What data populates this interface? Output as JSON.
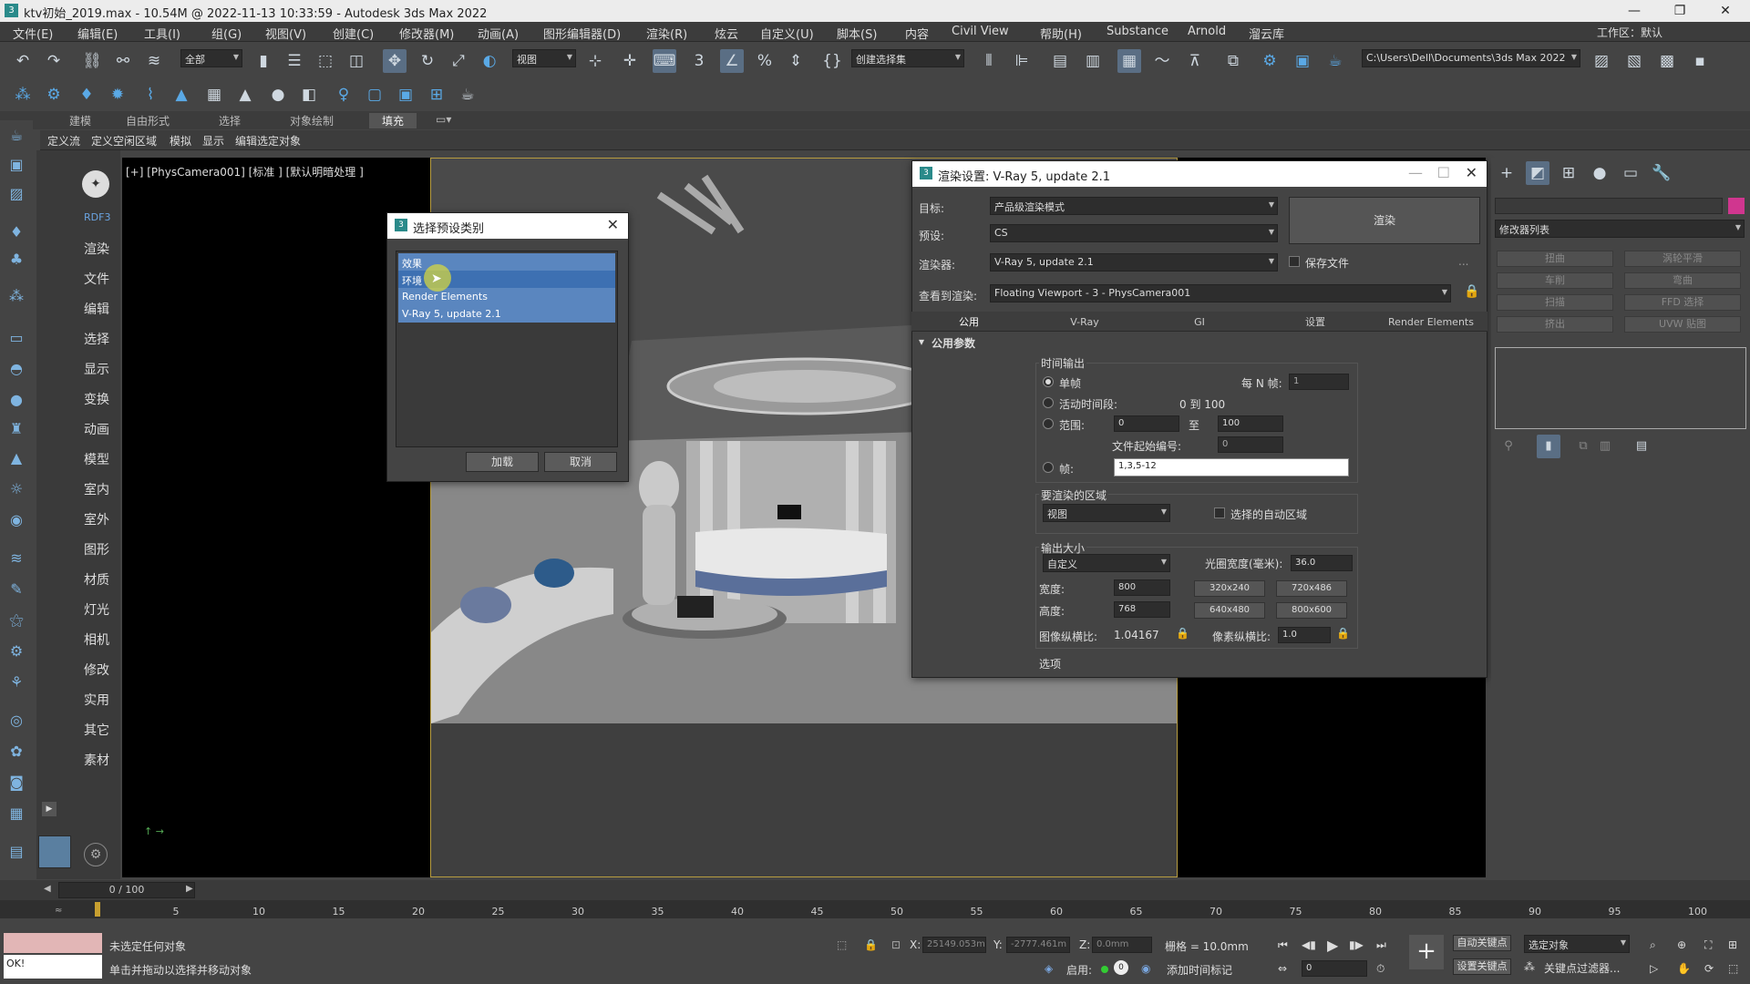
{
  "app": {
    "title": "ktv初始_2019.max - 10.54M @ 2022-11-13 10:33:59 - Autodesk 3ds Max 2022",
    "workspace_label": "工作区：",
    "workspace_value": "默认"
  },
  "menu": [
    "文件(E)",
    "编辑(E)",
    "工具(I)",
    "组(G)",
    "视图(V)",
    "创建(C)",
    "修改器(M)",
    "动画(A)",
    "图形编辑器(D)",
    "渲染(R)",
    "炫云",
    "自定义(U)",
    "脚本(S)",
    "内容",
    "Civil View",
    "帮助(H)",
    "Substance",
    "Arnold",
    "溜云库"
  ],
  "toolbar": {
    "filter_dropdown": "全部",
    "view_dropdown": "视图",
    "selection_set_dropdown": "创建选择集",
    "path_dropdown": "C:\\Users\\Dell\\Documents\\3ds Max 2022"
  },
  "ribbon": {
    "tabs": [
      "建模",
      "自由形式",
      "选择",
      "对象绘制",
      "填充"
    ],
    "active_tab": "填充",
    "sub_items": [
      "定义流",
      "定义空闲区域",
      "模拟",
      "显示",
      "编辑选定对象"
    ]
  },
  "side_commands": {
    "logo_label": "RDF3",
    "items": [
      "渲染",
      "文件",
      "编辑",
      "选择",
      "显示",
      "变换",
      "动画",
      "模型",
      "室内",
      "室外",
      "图形",
      "材质",
      "灯光",
      "相机",
      "修改",
      "实用",
      "其它",
      "素材"
    ]
  },
  "viewport": {
    "label": "[+] [PhysCamera001] [标准 ] [默认明暗处理 ]"
  },
  "preset_dialog": {
    "title": "选择预设类别",
    "items": [
      "效果",
      "环境",
      "Render Elements",
      "V-Ray 5, update 2.1"
    ],
    "load_button": "加载",
    "cancel_button": "取消"
  },
  "render_setup": {
    "title": "渲染设置: V-Ray 5, update 2.1",
    "target_label": "目标:",
    "target_value": "产品级渲染模式",
    "preset_label": "预设:",
    "preset_value": "CS",
    "renderer_label": "渲染器:",
    "renderer_value": "V-Ray 5, update 2.1",
    "save_file_label": "保存文件",
    "view_label": "查看到渲染:",
    "view_value": "Floating Viewport - 3 - PhysCamera001",
    "render_button": "渲染",
    "more_label": "...",
    "tabs": [
      "公用",
      "V-Ray",
      "GI",
      "设置",
      "Render Elements"
    ],
    "active_tab": "公用",
    "rollout_title": "公用参数",
    "time_output": {
      "group_label": "时间输出",
      "single": "单帧",
      "every_n_label": "每 N 帧:",
      "every_n_value": "1",
      "active_segment": "活动时间段:",
      "active_range": "0 到 100",
      "range": "范围:",
      "range_from": "0",
      "range_to_label": "至",
      "range_to": "100",
      "file_number_label": "文件起始编号:",
      "file_number_value": "0",
      "frames_label": "帧:",
      "frames_value": "1,3,5-12"
    },
    "area": {
      "group_label": "要渲染的区域",
      "dropdown": "视图",
      "auto_region": "选择的自动区域"
    },
    "output_size": {
      "group_label": "输出大小",
      "dropdown": "自定义",
      "aperture_label": "光圈宽度(毫米):",
      "aperture_value": "36.0",
      "width_label": "宽度:",
      "width_value": "800",
      "height_label": "高度:",
      "height_value": "768",
      "presets": [
        "320x240",
        "720x486",
        "640x480",
        "800x600"
      ],
      "image_aspect_label": "图像纵横比:",
      "image_aspect_value": "1.04167",
      "pixel_aspect_label": "像素纵横比:",
      "pixel_aspect_value": "1.0"
    },
    "options_label": "选项"
  },
  "right_panel": {
    "modifier_list": "修改器列表",
    "buttons": [
      "扭曲",
      "涡轮平滑",
      "车削",
      "弯曲",
      "扫描",
      "FFD 选择",
      "挤出",
      "UVW 贴图"
    ]
  },
  "timeline": {
    "frame_counter": "0 / 100",
    "ticks": [
      "5",
      "10",
      "15",
      "20",
      "25",
      "30",
      "35",
      "40",
      "45",
      "50",
      "55",
      "60",
      "65",
      "70",
      "75",
      "80",
      "85",
      "90",
      "95",
      "100"
    ]
  },
  "status": {
    "no_selection": "未选定任何对象",
    "hint": "单击并拖动以选择并移动对象",
    "ok": "OK!",
    "x_label": "X:",
    "x_value": "25149.053m",
    "y_label": "Y:",
    "y_value": "-2777.461m",
    "z_label": "Z:",
    "z_value": "0.0mm",
    "grid": "栅格 = 10.0mm",
    "enable_label": "启用:",
    "add_time_tag": "添加时间标记",
    "auto_key": "自动关键点",
    "set_key": "设置关键点",
    "key_filter": "关键点过滤器...",
    "selected_object": "选定对象",
    "frame_value": "0"
  }
}
